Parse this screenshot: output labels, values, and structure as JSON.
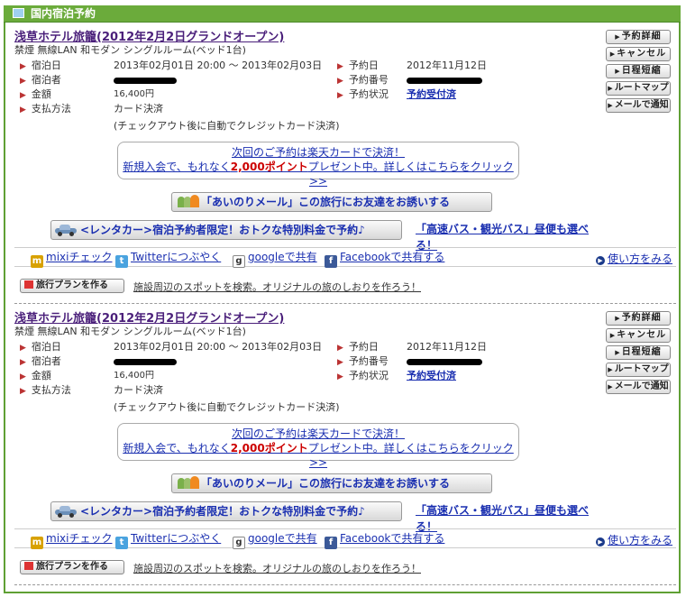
{
  "header": {
    "title": "国内宿泊予約"
  },
  "reservations": [
    {
      "hotel_name": "浅草ホテル旅籠(2012年2月2日グランドオープン)",
      "room": "禁煙 無線LAN 和モダン シングルルーム(ベッド1台)",
      "labels": {
        "stay": "宿泊日",
        "guest": "宿泊者",
        "price": "金額",
        "payment": "支払方法",
        "booking_date": "予約日",
        "booking_no": "予約番号",
        "status": "予約状況"
      },
      "stay_dates": "2013年02月01日 20:00 〜 2013年02月03日",
      "price": "16,400円",
      "payment": "カード決済",
      "payment_note": "(チェックアウト後に自動でクレジットカード決済)",
      "booking_date": "2012年11月12日",
      "status": "予約受付済",
      "buttons": {
        "detail": "予約詳細",
        "cancel": "キャンセル",
        "shorten": "日程短縮",
        "route": "ルートマップ",
        "mail": "メールで通知"
      },
      "promo_line1": "次回のご予約は楽天カードで決済！",
      "promo_line2a": "新規入会で、もれなく",
      "promo_points": "2,000ポイント",
      "promo_line2b": "プレゼント中。詳しくはこちらをクリック>>",
      "invite": "「あいのりメール」この旅行にお友達をお誘いする",
      "rental": "<レンタカー>宿泊予約者限定！おトクな特別料金で予約♪",
      "bus": "「高速バス・観光バス」昼便も選べる！",
      "share": {
        "mixi": "mixiチェック",
        "twitter": "Twitterにつぶやく",
        "google": "googleで共有",
        "facebook": "Facebookで共有する"
      },
      "howto": "使い方をみる",
      "plan_button": "旅行プランを作る",
      "plan_text": "施設周辺のスポットを検索。オリジナルの旅のしおりを作ろう！"
    },
    {
      "hotel_name": "浅草ホテル旅籠(2012年2月2日グランドオープン)",
      "room": "禁煙 無線LAN 和モダン シングルルーム(ベッド1台)",
      "labels": {
        "stay": "宿泊日",
        "guest": "宿泊者",
        "price": "金額",
        "payment": "支払方法",
        "booking_date": "予約日",
        "booking_no": "予約番号",
        "status": "予約状況"
      },
      "stay_dates": "2013年02月01日 20:00 〜 2013年02月03日",
      "price": "16,400円",
      "payment": "カード決済",
      "payment_note": "(チェックアウト後に自動でクレジットカード決済)",
      "booking_date": "2012年11月12日",
      "status": "予約受付済",
      "buttons": {
        "detail": "予約詳細",
        "cancel": "キャンセル",
        "shorten": "日程短縮",
        "route": "ルートマップ",
        "mail": "メールで通知"
      },
      "promo_line1": "次回のご予約は楽天カードで決済！",
      "promo_line2a": "新規入会で、もれなく",
      "promo_points": "2,000ポイント",
      "promo_line2b": "プレゼント中。詳しくはこちらをクリック>>",
      "invite": "「あいのりメール」この旅行にお友達をお誘いする",
      "rental": "<レンタカー>宿泊予約者限定！おトクな特別料金で予約♪",
      "bus": "「高速バス・観光バス」昼便も選べる！",
      "share": {
        "mixi": "mixiチェック",
        "twitter": "Twitterにつぶやく",
        "google": "googleで共有",
        "facebook": "Facebookで共有する"
      },
      "howto": "使い方をみる",
      "plan_button": "旅行プランを作る",
      "plan_text": "施設周辺のスポットを検索。オリジナルの旅のしおりを作ろう！"
    }
  ]
}
